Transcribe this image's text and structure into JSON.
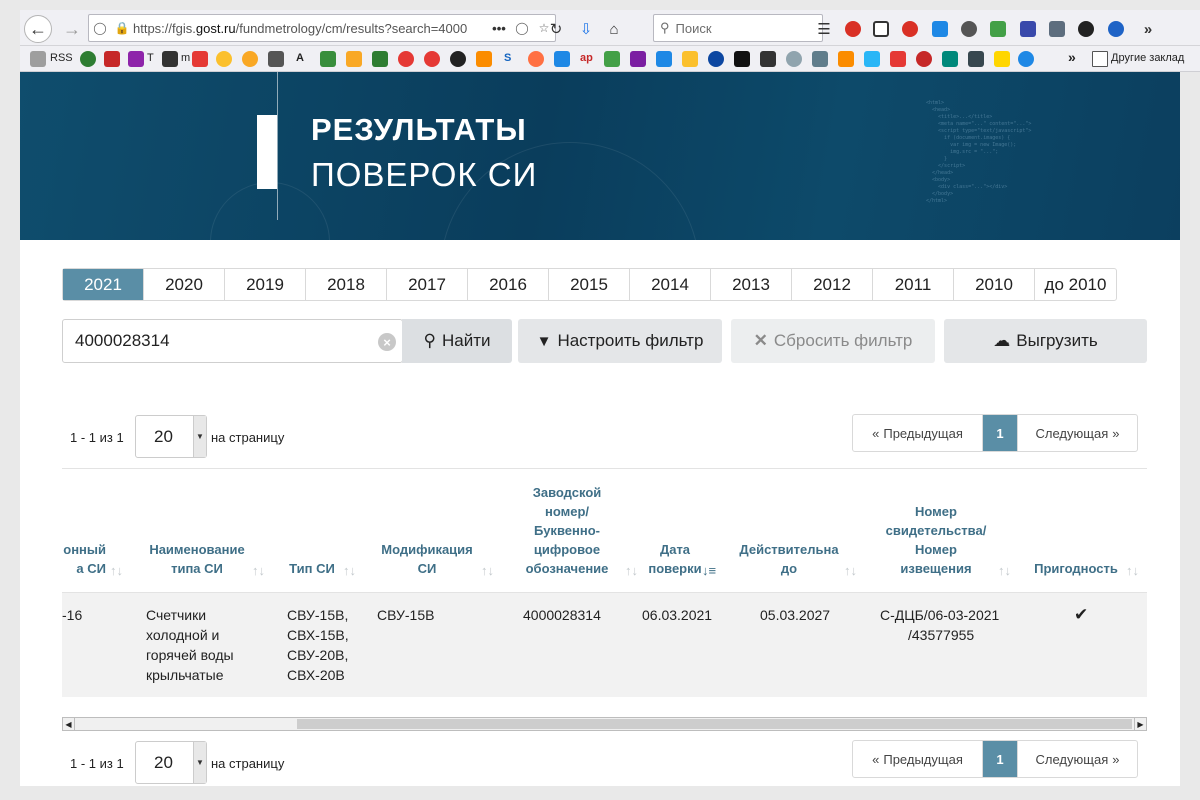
{
  "browser": {
    "url_prefix": "https://fgis.",
    "url_domain": "gost.ru",
    "url_rest": "/fundmetrology/cm/results?search=4000",
    "search_placeholder": "Поиск",
    "bookmarks_rss": "RSS",
    "bookmarks_t": "T",
    "bookmarks_m": "m",
    "bookmarks_a": "A",
    "bookmarks_s": "S",
    "bookmarks_ap": "ap",
    "bookmarks_other": "Другие заклад"
  },
  "hero": {
    "title_line1": "РЕЗУЛЬТАТЫ",
    "title_line2": "ПОВЕРОК СИ"
  },
  "years": [
    "2021",
    "2020",
    "2019",
    "2018",
    "2017",
    "2016",
    "2015",
    "2014",
    "2013",
    "2012",
    "2011",
    "2010",
    "до 2010"
  ],
  "search": {
    "value": "4000028314",
    "find_label": "Найти",
    "filter_label": "Настроить фильтр",
    "reset_label": "Сбросить фильтр",
    "export_label": "Выгрузить"
  },
  "pagination": {
    "range": "1 - 1 из 1",
    "per_page": "20",
    "per_page_label": "на страницу",
    "prev_label": "Предыдущая",
    "current_page": "1",
    "next_label": "Следующая"
  },
  "table": {
    "headers": {
      "reg_line1": "онный",
      "reg_line2": "а СИ",
      "name_line1": "Наименование",
      "name_line2": "типа СИ",
      "type": "Тип СИ",
      "mod_line1": "Модификация",
      "mod_line2": "СИ",
      "serial_line1": "Заводской",
      "serial_line2": "номер/",
      "serial_line3": "Буквенно-",
      "serial_line4": "цифровое",
      "serial_line5": "обозначение",
      "date_line1": "Дата",
      "date_line2": "поверки",
      "valid_line1": "Действительна",
      "valid_line2": "до",
      "cert_line1": "Номер",
      "cert_line2": "свидетельства/",
      "cert_line3": "Номер",
      "cert_line4": "извещения",
      "suit": "Пригодность"
    },
    "row": {
      "reg": "-16",
      "name_line1": "Счетчики",
      "name_line2": "холодной и",
      "name_line3": "горячей воды",
      "name_line4": "крыльчатые",
      "type_line1": "СВУ-15В,",
      "type_line2": "СВХ-15В,",
      "type_line3": "СВУ-20В,",
      "type_line4": "СВХ-20В",
      "mod": "СВУ-15В",
      "serial": "4000028314",
      "date": "06.03.2021",
      "valid": "05.03.2027",
      "cert_line1": "С-ДЦБ/06-03-2021",
      "cert_line2": "/43577955",
      "suit_icon": "check-icon"
    }
  }
}
